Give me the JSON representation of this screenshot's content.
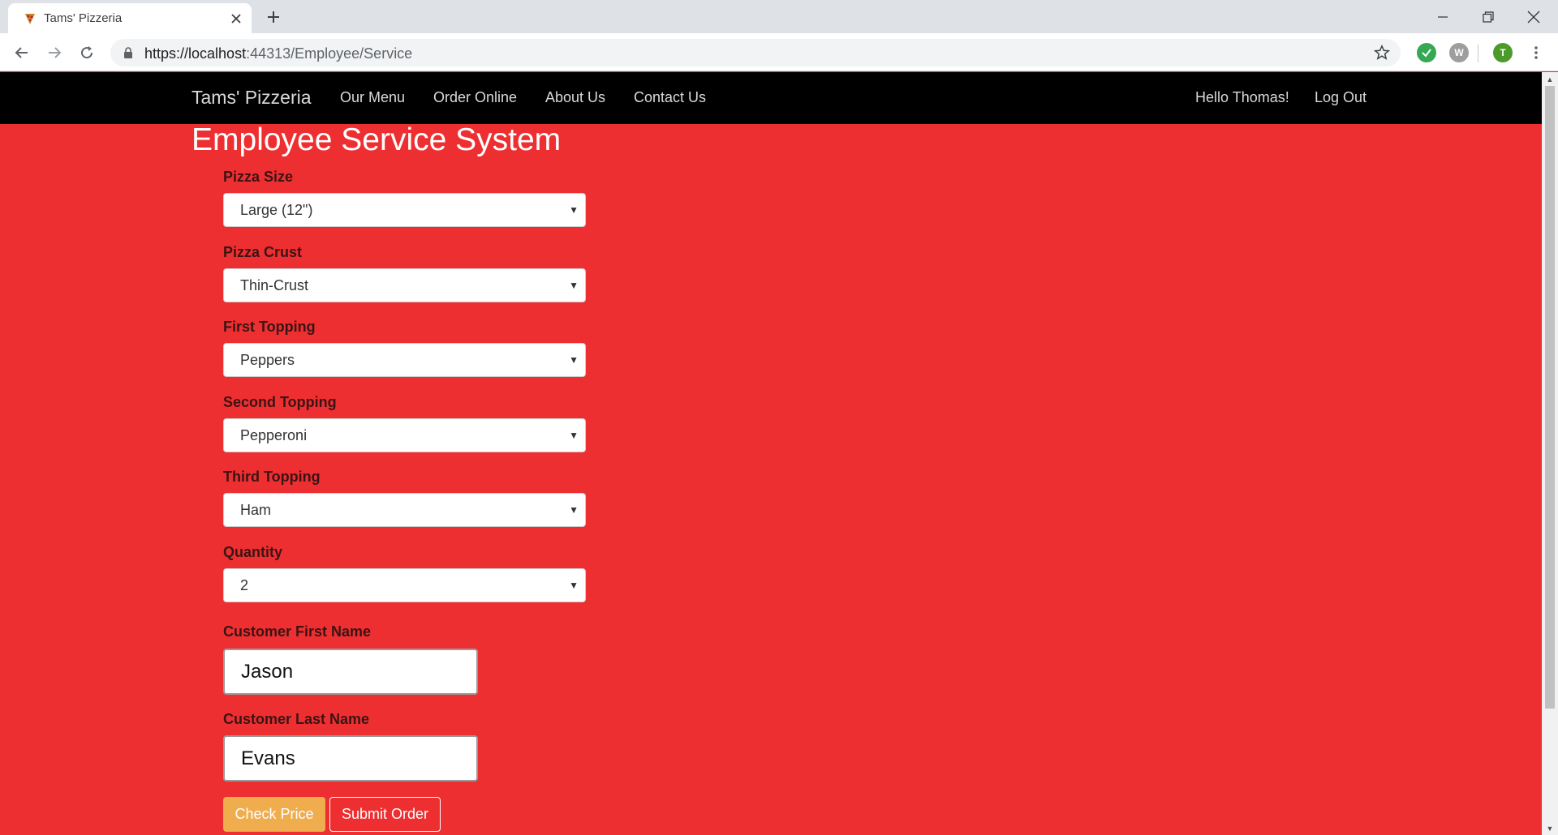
{
  "browser": {
    "tab_title": "Tams' Pizzeria",
    "url_host": "https://localhost",
    "url_path": ":44313/Employee/Service",
    "profile_initial": "T",
    "ext_w_letter": "W"
  },
  "navbar": {
    "brand": "Tams' Pizzeria",
    "links": [
      "Our Menu",
      "Order Online",
      "About Us",
      "Contact Us"
    ],
    "greeting": "Hello Thomas!",
    "logout": "Log Out"
  },
  "page": {
    "title": "Employee Service System"
  },
  "form": {
    "pizza_size": {
      "label": "Pizza Size",
      "value": "Large (12\")"
    },
    "pizza_crust": {
      "label": "Pizza Crust",
      "value": "Thin-Crust"
    },
    "first_topping": {
      "label": "First Topping",
      "value": "Peppers"
    },
    "second_topping": {
      "label": "Second Topping",
      "value": "Pepperoni"
    },
    "third_topping": {
      "label": "Third Topping",
      "value": "Ham"
    },
    "quantity": {
      "label": "Quantity",
      "value": "2"
    },
    "first_name": {
      "label": "Customer First Name",
      "value": "Jason"
    },
    "last_name": {
      "label": "Customer Last Name",
      "value": "Evans"
    },
    "check_price": "Check Price",
    "submit_order": "Submit Order"
  },
  "colors": {
    "page_background": "#ee2f31",
    "navbar": "#000000",
    "check_price_button": "#f0ad4e"
  }
}
